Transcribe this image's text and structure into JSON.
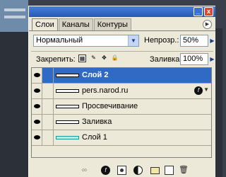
{
  "tabs": [
    "Слои",
    "Каналы",
    "Контуры"
  ],
  "palette_menu_icon": "palette-menu-arrow-icon",
  "window_buttons": {
    "minimize": "_",
    "close": "x"
  },
  "blend_mode": "Нормальный",
  "opacity": {
    "label": "Непрозр.:",
    "value": "50%"
  },
  "lock": {
    "label": "Закрепить:",
    "icons": [
      "lock-transparency-icon",
      "lock-image-icon",
      "lock-position-icon",
      "lock-all-icon"
    ]
  },
  "fill": {
    "label": "Заливка:",
    "value": "100%"
  },
  "layers": [
    {
      "name": "Слой 2",
      "selected": true
    },
    {
      "name": "pers.narod.ru",
      "has_effects": true
    },
    {
      "name": "Просвечивание"
    },
    {
      "name": "Заливка"
    },
    {
      "name": "Слой 1"
    }
  ],
  "fx_glyph": "f",
  "bottom_tools": [
    "link-layers-icon",
    "layer-style-icon",
    "layer-mask-icon",
    "adjustment-layer-icon",
    "new-group-icon",
    "new-layer-icon",
    "delete-layer-icon"
  ],
  "colors": {
    "accent": "#316ac5",
    "panel": "#ece9d8",
    "titlebar": "#2458b8"
  }
}
